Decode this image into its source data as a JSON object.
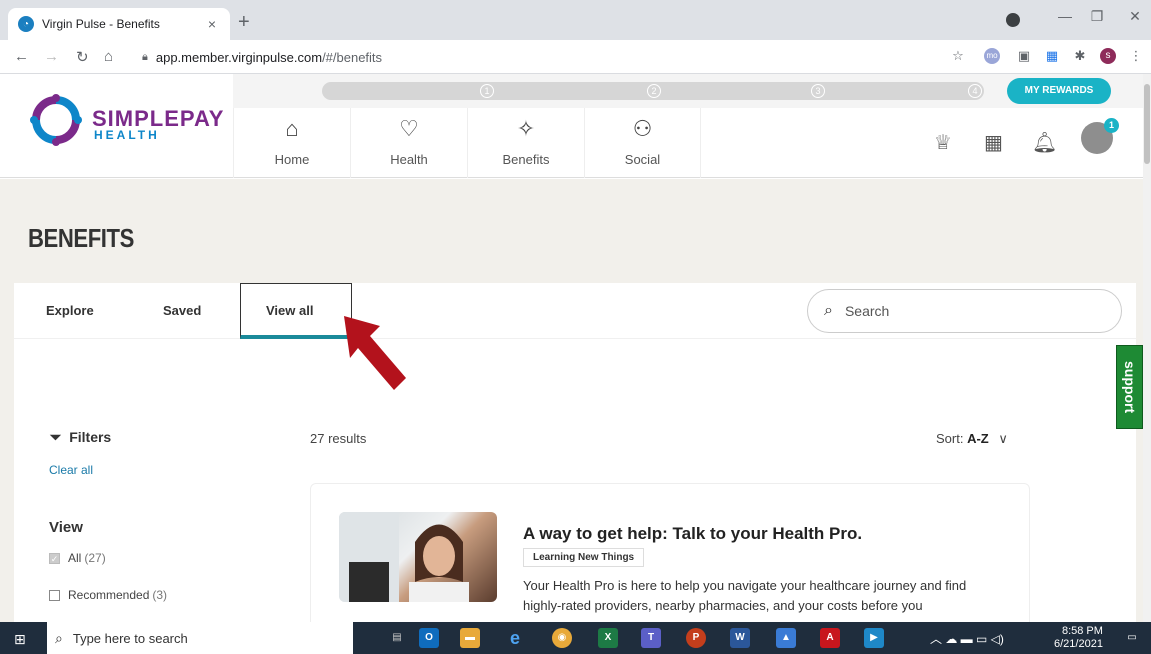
{
  "browser": {
    "tab_title": "Virgin Pulse - Benefits",
    "tab_close": "×",
    "new_tab": "+",
    "url_host": "app.member.virginpulse.com",
    "url_path": "/#/benefits"
  },
  "header": {
    "logo_main": "SIMPLEPAY",
    "logo_sub": "HEALTH",
    "steps": [
      "1",
      "2",
      "3",
      "4"
    ],
    "rewards_label": "MY REWARDS",
    "nav": [
      {
        "label": "Home",
        "icon": "home-icon"
      },
      {
        "label": "Health",
        "icon": "heart-icon"
      },
      {
        "label": "Benefits",
        "icon": "hand-star-icon"
      },
      {
        "label": "Social",
        "icon": "people-icon"
      }
    ],
    "notification_count": "1"
  },
  "page": {
    "title": "BENEFITS",
    "tabs": [
      {
        "label": "Explore"
      },
      {
        "label": "Saved"
      },
      {
        "label": "View all"
      }
    ],
    "search_placeholder": "Search"
  },
  "filters": {
    "title": "Filters",
    "clear_all": "Clear all",
    "view_title": "View",
    "options": [
      {
        "label": "All",
        "count": "(27)",
        "checked": true
      },
      {
        "label": "Recommended",
        "count": "(3)",
        "checked": false
      }
    ]
  },
  "results": {
    "count_label": "27 results",
    "sort_label": "Sort:",
    "sort_value": "A-Z"
  },
  "card": {
    "title": "A way to get help: Talk to your Health Pro.",
    "tag": "Learning New Things",
    "description": "Your Health Pro is here to help you navigate your healthcare journey and find highly-rated providers, nearby pharmacies, and your costs before you"
  },
  "support_label": "support",
  "taskbar": {
    "search_placeholder": "Type here to search",
    "time": "8:58 PM",
    "date": "6/21/2021"
  },
  "colors": {
    "accent": "#1ab3c6",
    "tab_underline": "#1a8a9a",
    "logo_purple": "#7b2a8a",
    "logo_blue": "#0e86c9",
    "support_green": "#1e8a34",
    "arrow_red": "#b3121c"
  }
}
